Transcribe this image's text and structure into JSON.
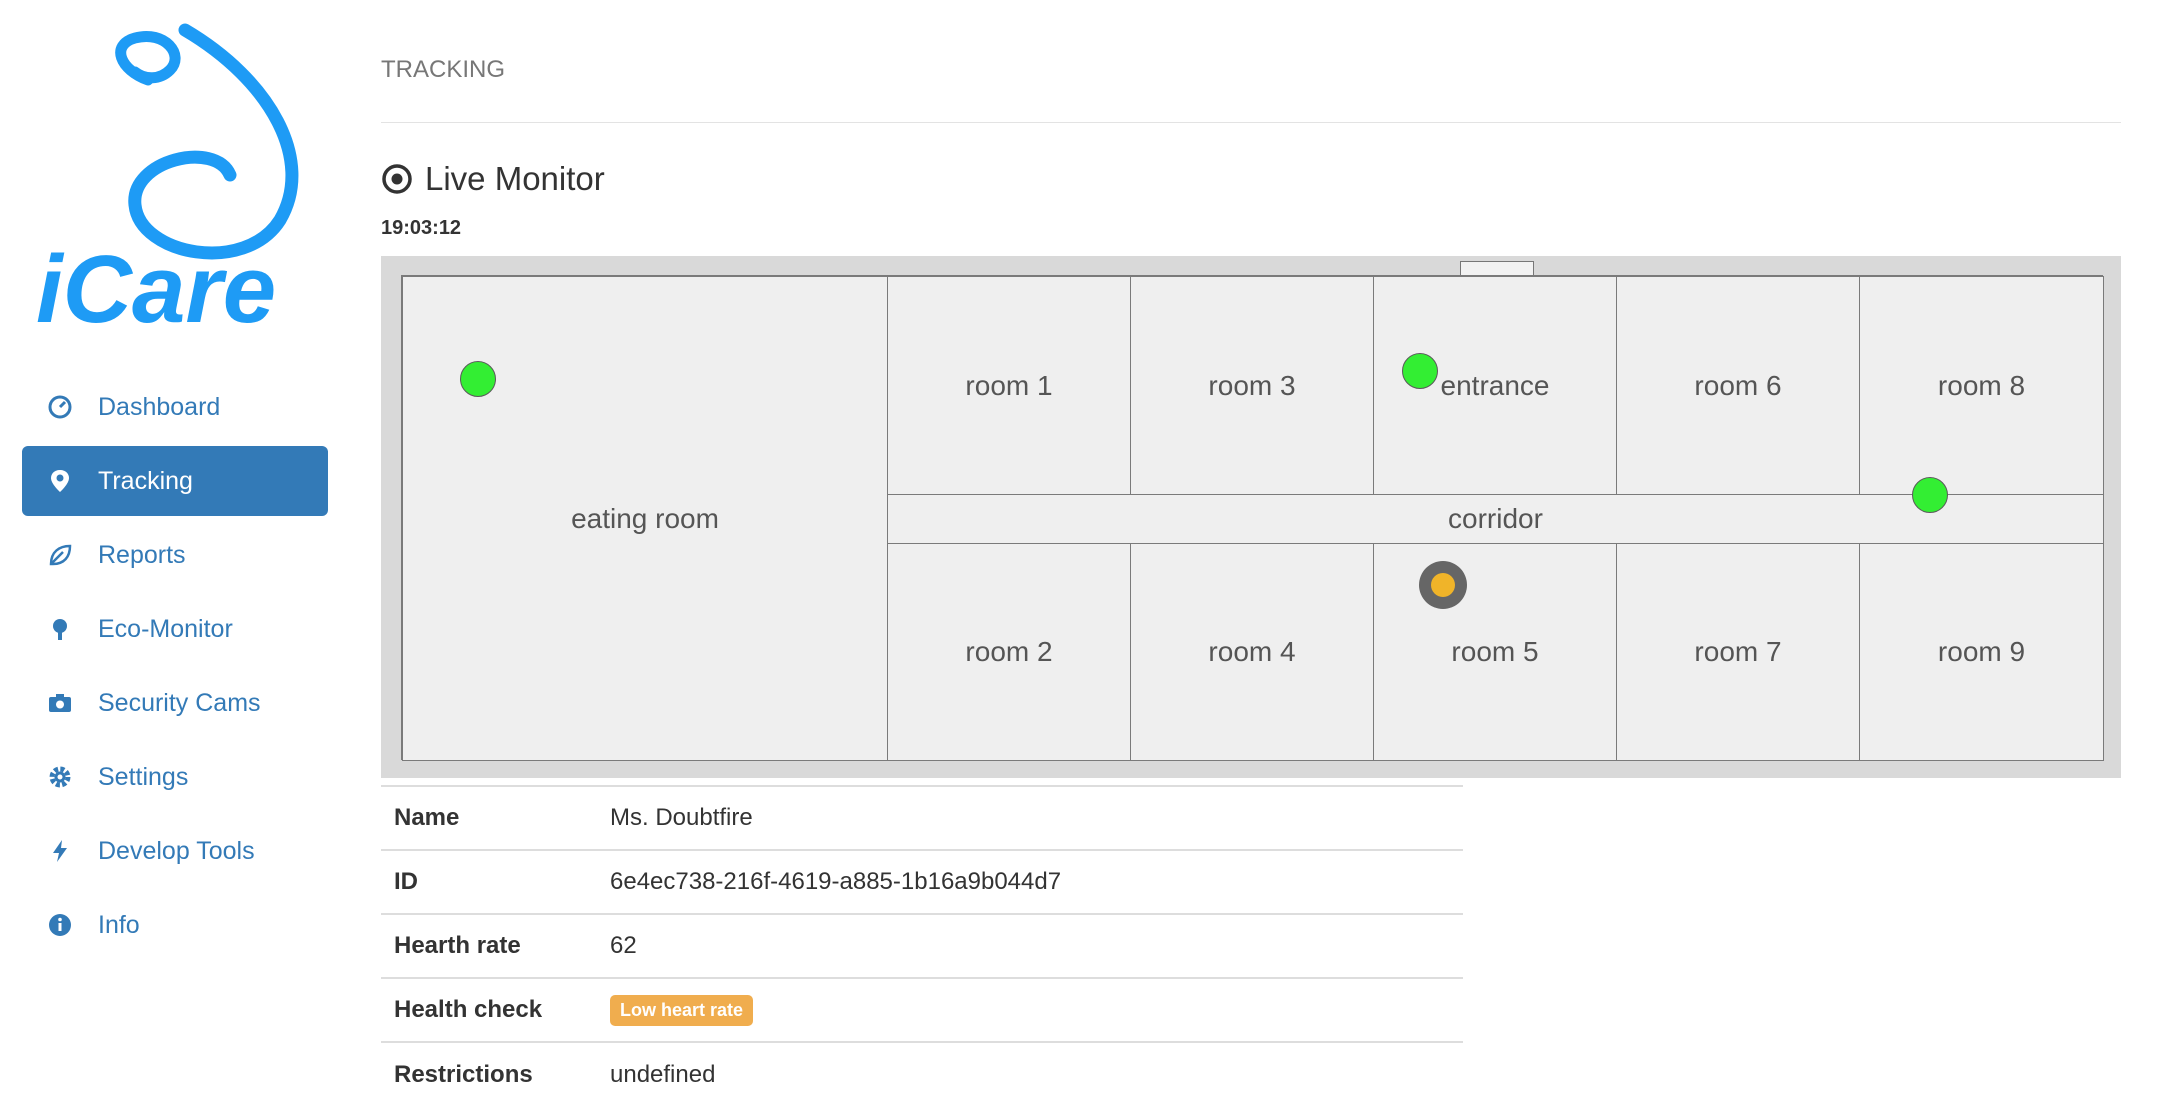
{
  "app": {
    "logo_text": "iCare"
  },
  "sidebar": {
    "items": [
      {
        "label": "Dashboard",
        "icon": "dashboard-icon",
        "active": false
      },
      {
        "label": "Tracking",
        "icon": "map-marker-icon",
        "active": true
      },
      {
        "label": "Reports",
        "icon": "leaf-icon",
        "active": false
      },
      {
        "label": "Eco-Monitor",
        "icon": "tree-icon",
        "active": false
      },
      {
        "label": "Security Cams",
        "icon": "camera-icon",
        "active": false
      },
      {
        "label": "Settings",
        "icon": "gear-icon",
        "active": false
      },
      {
        "label": "Develop Tools",
        "icon": "flash-icon",
        "active": false
      },
      {
        "label": "Info",
        "icon": "info-icon",
        "active": false
      }
    ]
  },
  "page": {
    "header": "TRACKING",
    "title": "Live Monitor",
    "clock": "19:03:12"
  },
  "map": {
    "rooms": {
      "eating": "eating room",
      "room1": "room 1",
      "room3": "room 3",
      "entrance": "entrance",
      "room6": "room 6",
      "room8": "room 8",
      "corridor": "corridor",
      "room2": "room 2",
      "room4": "room 4",
      "room5": "room 5",
      "room7": "room 7",
      "room9": "room 9"
    },
    "markers": [
      {
        "room": "eating room",
        "status": "ok",
        "color": "#33ee33"
      },
      {
        "room": "entrance",
        "status": "ok",
        "color": "#33ee33"
      },
      {
        "room": "room 5",
        "status": "warning",
        "color": "#f0b429"
      },
      {
        "room": "room 9",
        "status": "ok",
        "color": "#33ee33"
      }
    ]
  },
  "details": {
    "name_label": "Name",
    "name_value": "Ms. Doubtfire",
    "id_label": "ID",
    "id_value": "6e4ec738-216f-4619-a885-1b16a9b044d7",
    "rate_label": "Hearth rate",
    "rate_value": "62",
    "health_label": "Health check",
    "health_badge": "Low heart rate",
    "restrictions_label": "Restrictions",
    "restrictions_value": "undefined"
  },
  "colors": {
    "brand": "#1e9bf5",
    "nav_active": "#337ab7",
    "badge": "#f0ad4e"
  }
}
